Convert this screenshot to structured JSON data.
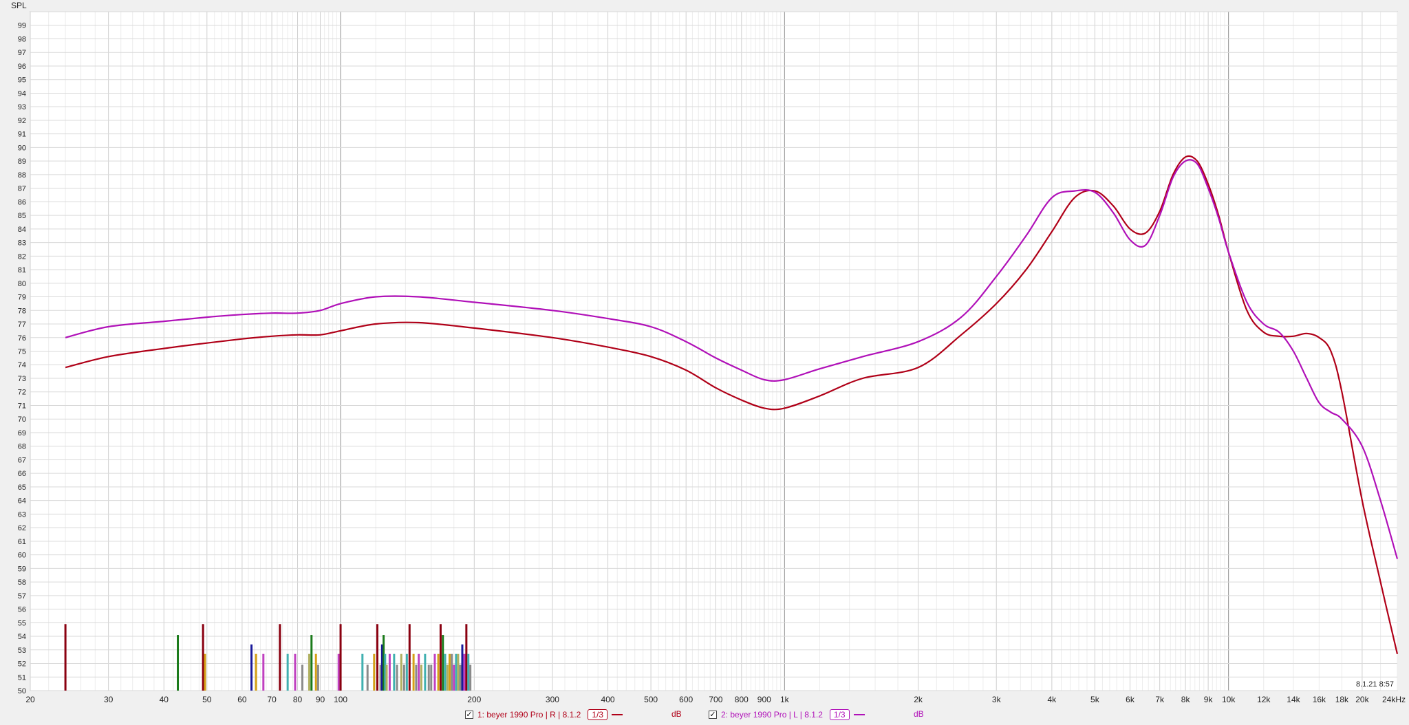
{
  "chart_data": {
    "type": "line",
    "ylabel": "SPL",
    "xunit_label": "24kHz",
    "timestamp": "8.1.21 8:57",
    "xscale": "log",
    "xlim": [
      20,
      24000
    ],
    "ylim": [
      50,
      100
    ],
    "grid": true,
    "y_ticks": [
      50,
      51,
      52,
      53,
      54,
      55,
      56,
      57,
      58,
      59,
      60,
      61,
      62,
      63,
      64,
      65,
      66,
      67,
      68,
      69,
      70,
      71,
      72,
      73,
      74,
      75,
      76,
      77,
      78,
      79,
      80,
      81,
      82,
      83,
      84,
      85,
      86,
      87,
      88,
      89,
      90,
      91,
      92,
      93,
      94,
      95,
      96,
      97,
      98,
      99
    ],
    "x_ticks": [
      {
        "v": 20,
        "label": "20"
      },
      {
        "v": 30,
        "label": "30"
      },
      {
        "v": 40,
        "label": "40"
      },
      {
        "v": 50,
        "label": "50"
      },
      {
        "v": 60,
        "label": "60"
      },
      {
        "v": 70,
        "label": "70"
      },
      {
        "v": 80,
        "label": "80"
      },
      {
        "v": 90,
        "label": "90"
      },
      {
        "v": 100,
        "label": "100"
      },
      {
        "v": 200,
        "label": "200"
      },
      {
        "v": 300,
        "label": "300"
      },
      {
        "v": 400,
        "label": "400"
      },
      {
        "v": 500,
        "label": "500"
      },
      {
        "v": 600,
        "label": "600"
      },
      {
        "v": 700,
        "label": "700"
      },
      {
        "v": 800,
        "label": "800"
      },
      {
        "v": 900,
        "label": "900"
      },
      {
        "v": 1000,
        "label": "1k"
      },
      {
        "v": 2000,
        "label": "2k"
      },
      {
        "v": 3000,
        "label": "3k"
      },
      {
        "v": 4000,
        "label": "4k"
      },
      {
        "v": 5000,
        "label": "5k"
      },
      {
        "v": 6000,
        "label": "6k"
      },
      {
        "v": 7000,
        "label": "7k"
      },
      {
        "v": 8000,
        "label": "8k"
      },
      {
        "v": 9000,
        "label": "9k"
      },
      {
        "v": 10000,
        "label": "10k"
      },
      {
        "v": 12000,
        "label": "12k"
      },
      {
        "v": 14000,
        "label": "14k"
      },
      {
        "v": 16000,
        "label": "16k"
      },
      {
        "v": 18000,
        "label": "18k"
      },
      {
        "v": 20000,
        "label": "20k"
      }
    ],
    "series": [
      {
        "name": "1: beyer 1990 Pro | R | 8.1.2",
        "color": "#b00018",
        "x": [
          24,
          30,
          40,
          50,
          60,
          70,
          80,
          90,
          100,
          120,
          150,
          200,
          300,
          400,
          500,
          600,
          700,
          800,
          900,
          1000,
          1200,
          1500,
          2000,
          2500,
          3000,
          3500,
          4000,
          4500,
          5000,
          5500,
          6000,
          6500,
          7000,
          7500,
          8000,
          8500,
          9000,
          9500,
          10000,
          11000,
          12000,
          13000,
          14000,
          15000,
          16000,
          17000,
          18000,
          20000,
          22000,
          24000
        ],
        "y": [
          73.8,
          74.6,
          75.2,
          75.6,
          75.9,
          76.1,
          76.2,
          76.2,
          76.5,
          77.0,
          77.1,
          76.7,
          76.0,
          75.3,
          74.6,
          73.6,
          72.3,
          71.4,
          70.8,
          70.8,
          71.7,
          73.0,
          73.8,
          76.2,
          78.5,
          81.0,
          83.8,
          86.3,
          86.8,
          85.7,
          84.0,
          83.7,
          85.3,
          88.0,
          89.3,
          89.0,
          87.3,
          85.0,
          82.3,
          78.0,
          76.4,
          76.1,
          76.1,
          76.3,
          76.0,
          75.0,
          72.0,
          64.0,
          58.0,
          52.7
        ]
      },
      {
        "name": "2: beyer 1990 Pro | L | 8.1.2",
        "color": "#b010b8",
        "x": [
          24,
          30,
          40,
          50,
          60,
          70,
          80,
          90,
          100,
          120,
          150,
          200,
          300,
          400,
          500,
          600,
          700,
          800,
          900,
          1000,
          1200,
          1500,
          2000,
          2500,
          3000,
          3500,
          4000,
          4500,
          5000,
          5500,
          6000,
          6500,
          7000,
          7500,
          8000,
          8500,
          9000,
          9500,
          10000,
          11000,
          12000,
          13000,
          14000,
          15000,
          16000,
          17000,
          18000,
          20000,
          22000,
          24000
        ],
        "y": [
          76.0,
          76.8,
          77.2,
          77.5,
          77.7,
          77.8,
          77.8,
          78.0,
          78.5,
          79.0,
          79.0,
          78.6,
          78.0,
          77.4,
          76.8,
          75.7,
          74.5,
          73.6,
          72.9,
          72.9,
          73.7,
          74.6,
          75.7,
          77.5,
          80.5,
          83.5,
          86.3,
          86.8,
          86.7,
          85.2,
          83.2,
          82.8,
          85.0,
          87.8,
          89.0,
          88.8,
          87.0,
          84.8,
          82.3,
          78.6,
          77.0,
          76.4,
          75.0,
          73.0,
          71.2,
          70.5,
          70.0,
          68.0,
          64.0,
          59.7
        ]
      }
    ],
    "bars": {
      "colors": [
        "#8a0010",
        "#1a7a1a",
        "#d4a017",
        "#1a1a9a",
        "#c040c0",
        "#40b0b0",
        "#8a8a8a",
        "#b0b060"
      ],
      "x": [
        24,
        43,
        49,
        49.5,
        63,
        64.5,
        67,
        73,
        76,
        79,
        82,
        85,
        86,
        88,
        89,
        99,
        100,
        112,
        115,
        119,
        121,
        123,
        124,
        125,
        126,
        127,
        129,
        132,
        134,
        137,
        139,
        141,
        143,
        146,
        148,
        150,
        152,
        155,
        158,
        160,
        163,
        166,
        168,
        170,
        172,
        174,
        176,
        178,
        180,
        182,
        184,
        186,
        188,
        190,
        192,
        194,
        196
      ],
      "y": [
        54.9,
        54.1,
        54.9,
        52.7,
        53.4,
        52.7,
        52.7,
        54.9,
        52.7,
        52.7,
        51.9,
        52.7,
        54.1,
        52.7,
        51.9,
        52.7,
        54.9,
        52.7,
        51.9,
        52.7,
        54.9,
        51.9,
        53.4,
        54.1,
        52.7,
        51.9,
        52.7,
        52.7,
        51.9,
        52.7,
        51.9,
        52.7,
        54.9,
        52.7,
        51.9,
        52.7,
        51.9,
        52.7,
        51.9,
        51.9,
        52.7,
        52.7,
        54.9,
        54.1,
        52.7,
        51.9,
        52.7,
        52.7,
        51.9,
        52.7,
        52.7,
        51.9,
        53.4,
        52.7,
        54.9,
        52.7,
        51.9
      ],
      "c": [
        0,
        1,
        0,
        2,
        3,
        2,
        4,
        0,
        5,
        4,
        6,
        7,
        1,
        2,
        6,
        4,
        0,
        5,
        6,
        2,
        0,
        6,
        3,
        1,
        5,
        7,
        4,
        5,
        6,
        7,
        6,
        5,
        0,
        2,
        6,
        4,
        7,
        5,
        6,
        6,
        4,
        2,
        0,
        1,
        5,
        7,
        2,
        6,
        4,
        5,
        7,
        6,
        3,
        4,
        0,
        5,
        6
      ]
    }
  },
  "legend": {
    "items": [
      {
        "label": "1: beyer 1990 Pro | R | 8.1.2",
        "smoothing": "1/3",
        "unit": "dB",
        "color": "#b00018"
      },
      {
        "label": "2: beyer 1990 Pro | L | 8.1.2",
        "smoothing": "1/3",
        "unit": "dB",
        "color": "#b010b8"
      }
    ]
  }
}
